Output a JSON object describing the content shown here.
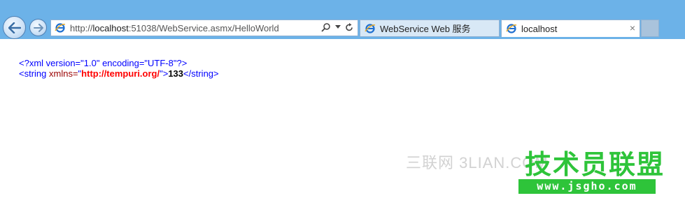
{
  "browser": {
    "address_url_prefix": "http://",
    "address_url_host": "localhost",
    "address_url_rest": ":51038/WebService.asmx/HelloWorld",
    "search_icon": "search-icon",
    "refresh_icon": "refresh-icon",
    "tabs": [
      {
        "label": "WebService Web 服务",
        "active": false
      },
      {
        "label": "localhost",
        "active": true,
        "close": "×"
      }
    ]
  },
  "xml": {
    "line1": "<?xml version=\"1.0\" encoding=\"UTF-8\"?>",
    "line2_open": "<string",
    "line2_attr": " xmlns=",
    "line2_q1": "\"",
    "line2_attr_value": "http://tempuri.org/",
    "line2_q2": "\">",
    "line2_text": "133",
    "line2_close": "</string>"
  },
  "watermark": {
    "site_cn": "三联网 3LIAN.COM",
    "brand_cn": "技术员联盟",
    "brand_url": "www.jsgho.com"
  },
  "colors": {
    "chrome_bg": "#6cb2e8",
    "xml_tag": "#0000ff",
    "xml_name": "#990000",
    "xml_attr_value": "#ff0000",
    "watermark_green": "#2ec43a"
  }
}
